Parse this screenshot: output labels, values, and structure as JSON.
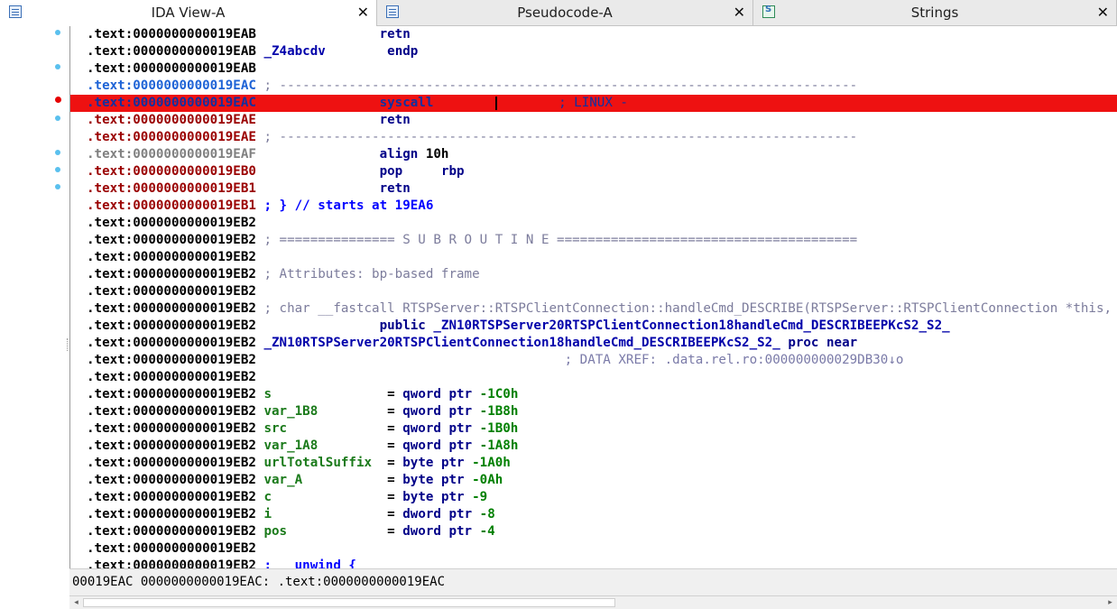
{
  "tabs": [
    {
      "label": "IDA View-A",
      "active": true,
      "icon": "ida-view-icon"
    },
    {
      "label": "Pseudocode-A",
      "active": false,
      "icon": "pseudocode-icon"
    },
    {
      "label": "Strings",
      "active": false,
      "icon": "strings-icon"
    }
  ],
  "close_glyph": "✕",
  "colors": {
    "highlight": "#ee1111",
    "breakpoint": "#e60000",
    "marker": "#5ac0ee"
  },
  "rows": [
    {
      "addr": ".text:0000000000019EAB",
      "addr_style": "",
      "text": "                retn"
    },
    {
      "addr": ".text:0000000000019EAB",
      "addr_style": "",
      "text": " _Z4abcdv        endp"
    },
    {
      "addr": ".text:0000000000019EAB",
      "addr_style": "",
      "text": ""
    },
    {
      "addr": ".text:0000000000019EAC",
      "addr_style": "blue",
      "text": " ; ---------------------------------------------------------------------------"
    },
    {
      "addr": ".text:0000000000019EAC",
      "addr_style": "blue",
      "text": "                syscall                 ; LINUX -",
      "highlight": true
    },
    {
      "addr": ".text:0000000000019EAE",
      "addr_style": "red",
      "text": "                retn"
    },
    {
      "addr": ".text:0000000000019EAE",
      "addr_style": "red",
      "text": " ; ---------------------------------------------------------------------------"
    },
    {
      "addr": ".text:0000000000019EAF",
      "addr_style": "gray",
      "text": "                align 10h"
    },
    {
      "addr": ".text:0000000000019EB0",
      "addr_style": "red",
      "text": "                pop     rbp"
    },
    {
      "addr": ".text:0000000000019EB1",
      "addr_style": "red",
      "text": "                retn"
    },
    {
      "addr": ".text:0000000000019EB1",
      "addr_style": "red",
      "text": " ; } // starts at 19EA6"
    },
    {
      "addr": ".text:0000000000019EB2",
      "addr_style": "",
      "text": ""
    },
    {
      "addr": ".text:0000000000019EB2",
      "addr_style": "",
      "text": " ; =============== S U B R O U T I N E ======================================="
    },
    {
      "addr": ".text:0000000000019EB2",
      "addr_style": "",
      "text": ""
    },
    {
      "addr": ".text:0000000000019EB2",
      "addr_style": "",
      "text": " ; Attributes: bp-based frame"
    },
    {
      "addr": ".text:0000000000019EB2",
      "addr_style": "",
      "text": ""
    },
    {
      "addr": ".text:0000000000019EB2",
      "addr_style": "",
      "text": " ; char __fastcall RTSPServer::RTSPClientConnection::handleCmd_DESCRIBE(RTSPServer::RTSPClientConnection *this, const char *, const char *, const char *)"
    },
    {
      "addr": ".text:0000000000019EB2",
      "addr_style": "",
      "text": "                public _ZN10RTSPServer20RTSPClientConnection18handleCmd_DESCRIBEEPKcS2_S2_"
    },
    {
      "addr": ".text:0000000000019EB2",
      "addr_style": "",
      "text": " _ZN10RTSPServer20RTSPClientConnection18handleCmd_DESCRIBEEPKcS2_S2_ proc near"
    },
    {
      "addr": ".text:0000000000019EB2",
      "addr_style": "",
      "text": "                                        ; DATA XREF: .data.rel.ro:000000000029DB30↓o"
    },
    {
      "addr": ".text:0000000000019EB2",
      "addr_style": "",
      "text": ""
    },
    {
      "addr": ".text:0000000000019EB2",
      "addr_style": "",
      "text": " s               = qword ptr -1C0h"
    },
    {
      "addr": ".text:0000000000019EB2",
      "addr_style": "",
      "text": " var_1B8         = qword ptr -1B8h"
    },
    {
      "addr": ".text:0000000000019EB2",
      "addr_style": "",
      "text": " src             = qword ptr -1B0h"
    },
    {
      "addr": ".text:0000000000019EB2",
      "addr_style": "",
      "text": " var_1A8         = qword ptr -1A8h"
    },
    {
      "addr": ".text:0000000000019EB2",
      "addr_style": "",
      "text": " urlTotalSuffix  = byte ptr -1A0h"
    },
    {
      "addr": ".text:0000000000019EB2",
      "addr_style": "",
      "text": " var_A           = byte ptr -0Ah"
    },
    {
      "addr": ".text:0000000000019EB2",
      "addr_style": "",
      "text": " c               = byte ptr -9"
    },
    {
      "addr": ".text:0000000000019EB2",
      "addr_style": "",
      "text": " i               = dword ptr -8"
    },
    {
      "addr": ".text:0000000000019EB2",
      "addr_style": "",
      "text": " pos             = dword ptr -4"
    },
    {
      "addr": ".text:0000000000019EB2",
      "addr_style": "",
      "text": ""
    },
    {
      "addr": ".text:0000000000019EB2",
      "addr_style": "",
      "text": " ; __unwind {"
    }
  ],
  "status": "00019EAC 0000000000019EAC: .text:0000000000019EAC",
  "scroll": {
    "left_arrow": "◂",
    "right_arrow": "▸"
  }
}
